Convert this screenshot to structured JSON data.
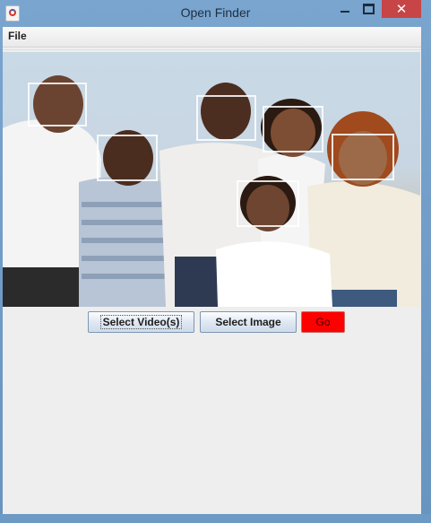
{
  "window": {
    "title": "Open Finder",
    "close_glyph": "✕"
  },
  "menu": {
    "items": [
      "File"
    ]
  },
  "buttons": {
    "select_videos": "Select Video(s)",
    "select_image": "Select Image",
    "go": "Go",
    "go_color": "#ff0000"
  },
  "image": {
    "faces_detected": 6
  },
  "icons": {
    "app": "java-icon",
    "minimize": "minimize-icon",
    "maximize": "maximize-icon",
    "close": "close-icon"
  }
}
